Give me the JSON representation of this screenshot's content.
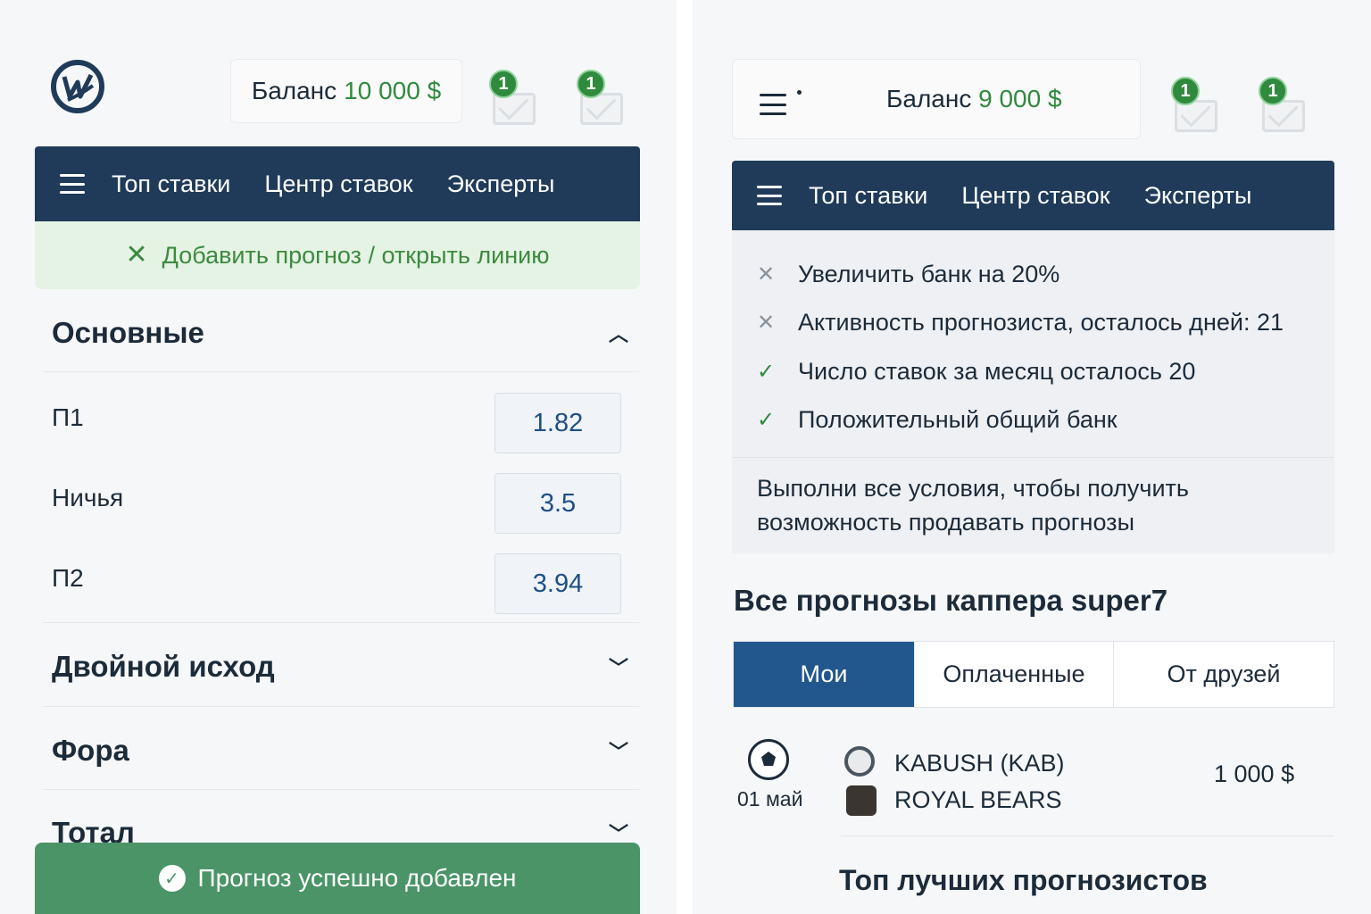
{
  "left": {
    "balance": {
      "label": "Баланс",
      "amount": "10 000 $"
    },
    "mail_badges": [
      "1",
      "1"
    ],
    "nav": {
      "items": [
        "Топ ставки",
        "Центр ставок",
        "Эксперты"
      ]
    },
    "add_forecast": {
      "icon": "close-icon",
      "label": "Добавить прогноз / открыть линию"
    },
    "sections": {
      "main": {
        "title": "Основные",
        "expanded": true
      },
      "double": {
        "title": "Двойной исход",
        "expanded": false
      },
      "handicap": {
        "title": "Фора",
        "expanded": false
      },
      "total": {
        "title": "Тотал",
        "expanded": false
      }
    },
    "odds": [
      {
        "label": "П1",
        "value": "1.82"
      },
      {
        "label": "Ничья",
        "value": "3.5"
      },
      {
        "label": "П2",
        "value": "3.94"
      }
    ],
    "toast": {
      "icon": "check-circle-icon",
      "message": "Прогноз успешно добавлен",
      "color": "#4a9468"
    }
  },
  "right": {
    "balance": {
      "label": "Баланс",
      "amount": "9 000 $"
    },
    "mail_badges": [
      "1",
      "1"
    ],
    "nav": {
      "items": [
        "Топ ставки",
        "Центр ставок",
        "Эксперты"
      ]
    },
    "conditions": [
      {
        "text": "Увеличить банк на 20%",
        "done": false
      },
      {
        "text": "Активность прогнозиста, осталось дней: 21",
        "done": false
      },
      {
        "text": "Число ставок за месяц осталось 20",
        "done": true
      },
      {
        "text": "Положительный общий банк",
        "done": true
      }
    ],
    "conditions_note": "Выполни все условия, чтобы получить возможность продавать прогнозы",
    "all_forecasts_title": "Все прогнозы каппера super7",
    "tabs": [
      "Мои",
      "Оплаченные",
      "От друзей"
    ],
    "active_tab": "Мои",
    "forecast": {
      "sport_icon": "soccer-ball-icon",
      "date": "01 май",
      "team1": "KABUSH (KAB)",
      "team2": "ROYAL BEARS",
      "amount": "1 000 $"
    },
    "top_forecasters_title": "Топ лучших прогнозистов"
  },
  "colors": {
    "nav": "#1f3b59",
    "accent_green": "#2f8a3d",
    "active_tab": "#22578e",
    "odds_text": "#1f4f86"
  }
}
